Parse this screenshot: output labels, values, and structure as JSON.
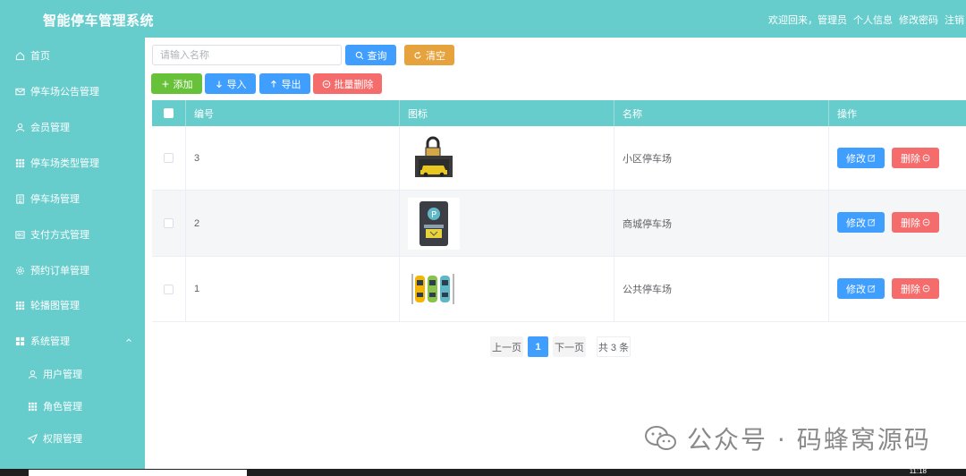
{
  "header": {
    "title": "智能停车管理系统",
    "welcome": "欢迎回来，管理员",
    "links": [
      "个人信息",
      "修改密码",
      "注销"
    ]
  },
  "sidebar": {
    "items": [
      {
        "label": "首页",
        "icon": "home-icon"
      },
      {
        "label": "停车场公告管理",
        "icon": "mail-icon"
      },
      {
        "label": "会员管理",
        "icon": "user-icon"
      },
      {
        "label": "停车场类型管理",
        "icon": "grid-icon"
      },
      {
        "label": "停车场管理",
        "icon": "building-icon"
      },
      {
        "label": "支付方式管理",
        "icon": "payment-icon"
      },
      {
        "label": "预约订单管理",
        "icon": "gear-icon"
      },
      {
        "label": "轮播图管理",
        "icon": "grid-icon"
      },
      {
        "label": "系统管理",
        "icon": "apps-icon",
        "expanded": true
      }
    ],
    "subitems": [
      {
        "label": "用户管理",
        "icon": "user-icon"
      },
      {
        "label": "角色管理",
        "icon": "grid-icon"
      },
      {
        "label": "权限管理",
        "icon": "send-icon"
      }
    ]
  },
  "toolbar": {
    "search_placeholder": "请输入名称",
    "query_label": "查询",
    "clear_label": "清空",
    "add_label": "添加",
    "import_label": "导入",
    "export_label": "导出",
    "batch_delete_label": "批量删除"
  },
  "table": {
    "columns": [
      "编号",
      "图标",
      "名称",
      "操作"
    ],
    "rows": [
      {
        "id": "3",
        "name": "小区停车场",
        "icon": "garage-car-icon"
      },
      {
        "id": "2",
        "name": "商城停车场",
        "icon": "parking-meter-icon"
      },
      {
        "id": "1",
        "name": "公共停车场",
        "icon": "parked-cars-icon"
      }
    ],
    "edit_label": "修改",
    "delete_label": "删除"
  },
  "pagination": {
    "prev": "上一页",
    "current": "1",
    "next": "下一页",
    "total": "共 3 条"
  },
  "watermark": "公众号 · 码蜂窝源码",
  "taskbar": {
    "clock": "11:18"
  },
  "colors": {
    "primary_teal": "#67cdcc",
    "blue": "#409eff",
    "orange": "#e6a23c",
    "green": "#67c23a",
    "red": "#f56c6c"
  }
}
